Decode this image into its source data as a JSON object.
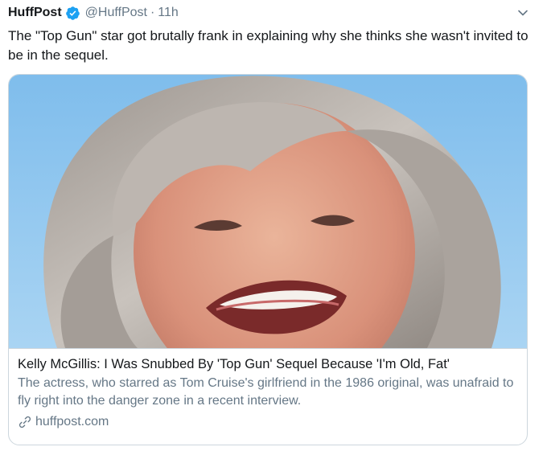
{
  "tweet": {
    "author_name": "HuffPost",
    "handle": "@HuffPost",
    "separator": "·",
    "time": "11h",
    "text": "The \"Top Gun\" star got brutally frank in explaining why she thinks she wasn't invited to be in the sequel."
  },
  "card": {
    "image_icon": "article-photo",
    "title": "Kelly McGillis: I Was Snubbed By 'Top Gun' Sequel Because 'I'm Old, Fat'",
    "description": "The actress, who starred as Tom Cruise's girlfriend in the 1986 original, was unafraid to fly right into the danger zone in a recent interview.",
    "domain": "huffpost.com"
  },
  "icons": {
    "verified": "verified-badge-icon",
    "caret": "chevron-down-icon",
    "link": "link-icon"
  },
  "colors": {
    "verified": "#1da1f2",
    "secondary_text": "#657786",
    "border": "#ccd6dd",
    "sky": "#8cc4ee"
  }
}
